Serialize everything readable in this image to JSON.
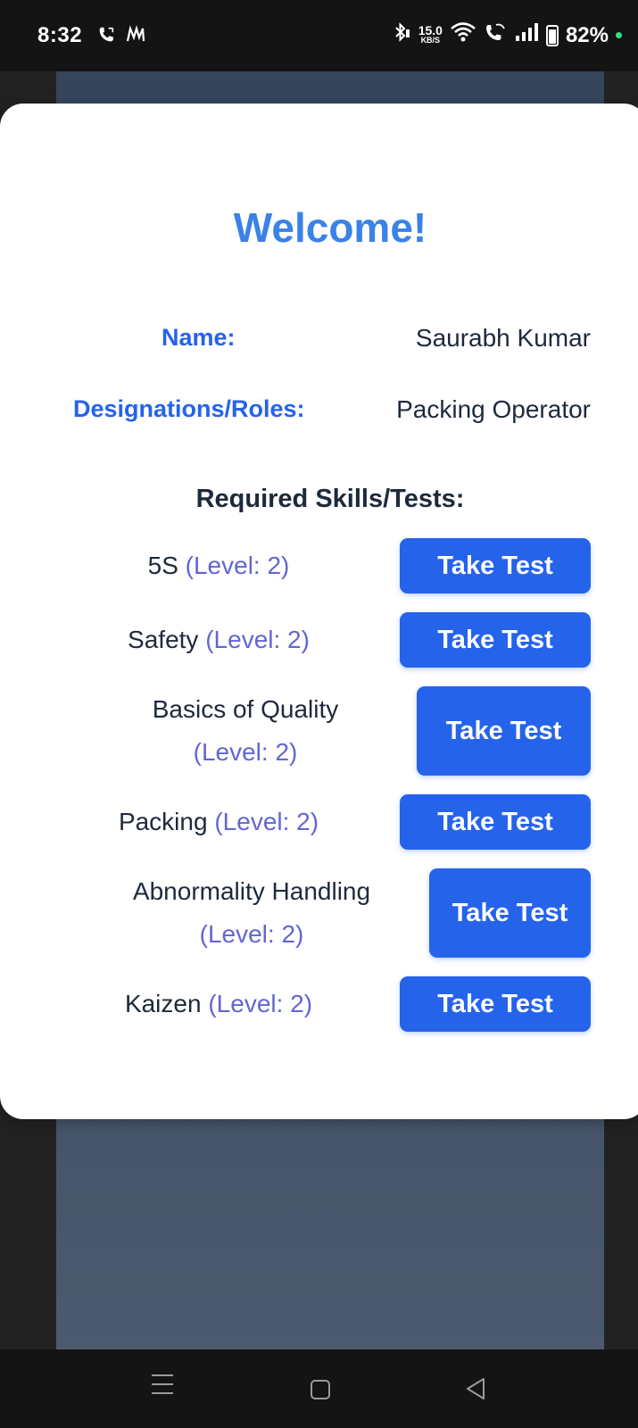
{
  "status_bar": {
    "time": "8:32",
    "net_speed_value": "15.0",
    "net_speed_unit": "KB/S",
    "battery": "82%",
    "icons": [
      "call-icon",
      "notification-app-icon",
      "bluetooth-icon",
      "wifi-icon",
      "wifi-call-icon",
      "signal-icon",
      "battery-icon"
    ]
  },
  "card": {
    "title": "Welcome!",
    "name_label": "Name:",
    "name_value": "Saurabh Kumar",
    "role_label": "Designations/Roles:",
    "role_value": "Packing Operator",
    "skills_heading": "Required Skills/Tests:",
    "skills": [
      {
        "name": "5S",
        "level": "(Level: 2)",
        "button": "Take Test"
      },
      {
        "name": "Safety",
        "level": "(Level: 2)",
        "button": "Take Test"
      },
      {
        "name": "Basics of Quality",
        "level": "(Level: 2)",
        "button": "Take Test"
      },
      {
        "name": "Packing",
        "level": "(Level: 2)",
        "button": "Take Test"
      },
      {
        "name": "Abnormality Handling",
        "level": "(Level: 2)",
        "button": "Take Test"
      },
      {
        "name": "Kaizen",
        "level": "(Level: 2)",
        "button": "Take Test"
      }
    ]
  },
  "nav_bar": {
    "icons": [
      "recent-apps-icon",
      "home-icon",
      "back-icon"
    ]
  },
  "colors": {
    "accent": "#2563eb",
    "title": "#3b82e8",
    "level_text": "#6366d1",
    "text": "#1e293b"
  }
}
